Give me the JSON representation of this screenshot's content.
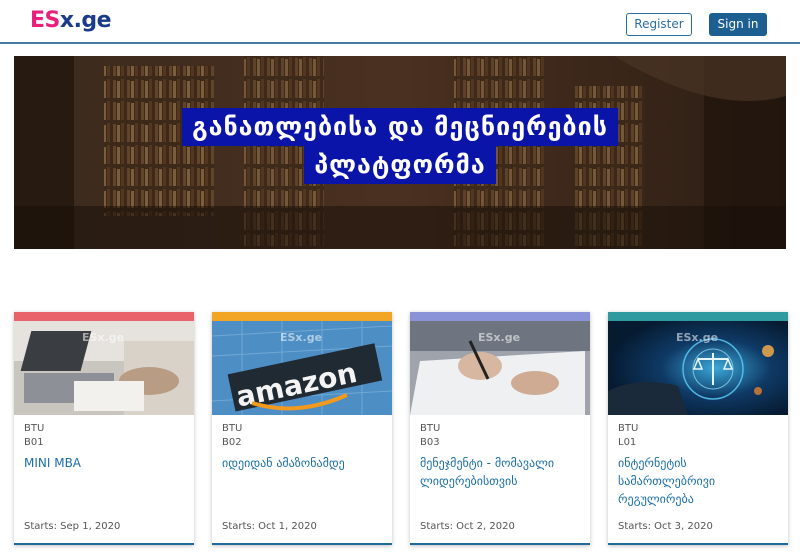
{
  "header": {
    "logo_es": "ES",
    "logo_rest": "x.ge",
    "register_label": "Register",
    "signin_label": "Sign in"
  },
  "hero": {
    "line1": "განათლებისა და მეცნიერების",
    "line2": "პლატფორმა"
  },
  "cards": [
    {
      "bar_color": "#e8636a",
      "watermark": "ESx.ge",
      "org": "BTU",
      "code": "B01",
      "title": "MINI MBA",
      "starts": "Starts: Sep 1, 2020"
    },
    {
      "bar_color": "#f2a524",
      "watermark": "ESx.ge",
      "org": "BTU",
      "code": "B02",
      "title": "იდეიდან ამაზონამდე",
      "starts": "Starts: Oct 1, 2020"
    },
    {
      "bar_color": "#8a93d8",
      "watermark": "ESx.ge",
      "org": "BTU",
      "code": "B03",
      "title": "მენეჯმენტი - მომავალი ლიდერებისთვის",
      "starts": "Starts: Oct 2, 2020"
    },
    {
      "bar_color": "#2f9aa0",
      "watermark": "ESx.ge",
      "org": "BTU",
      "code": "L01",
      "title": "ინტერნეტის სამართლებრივი რეგულირება",
      "starts": "Starts: Oct 3, 2020"
    }
  ],
  "colors": {
    "brand_pink": "#e8207a",
    "brand_navy": "#1a3a8a",
    "accent_blue": "#1e5f91",
    "hero_label_bg": "#0b14a8"
  }
}
